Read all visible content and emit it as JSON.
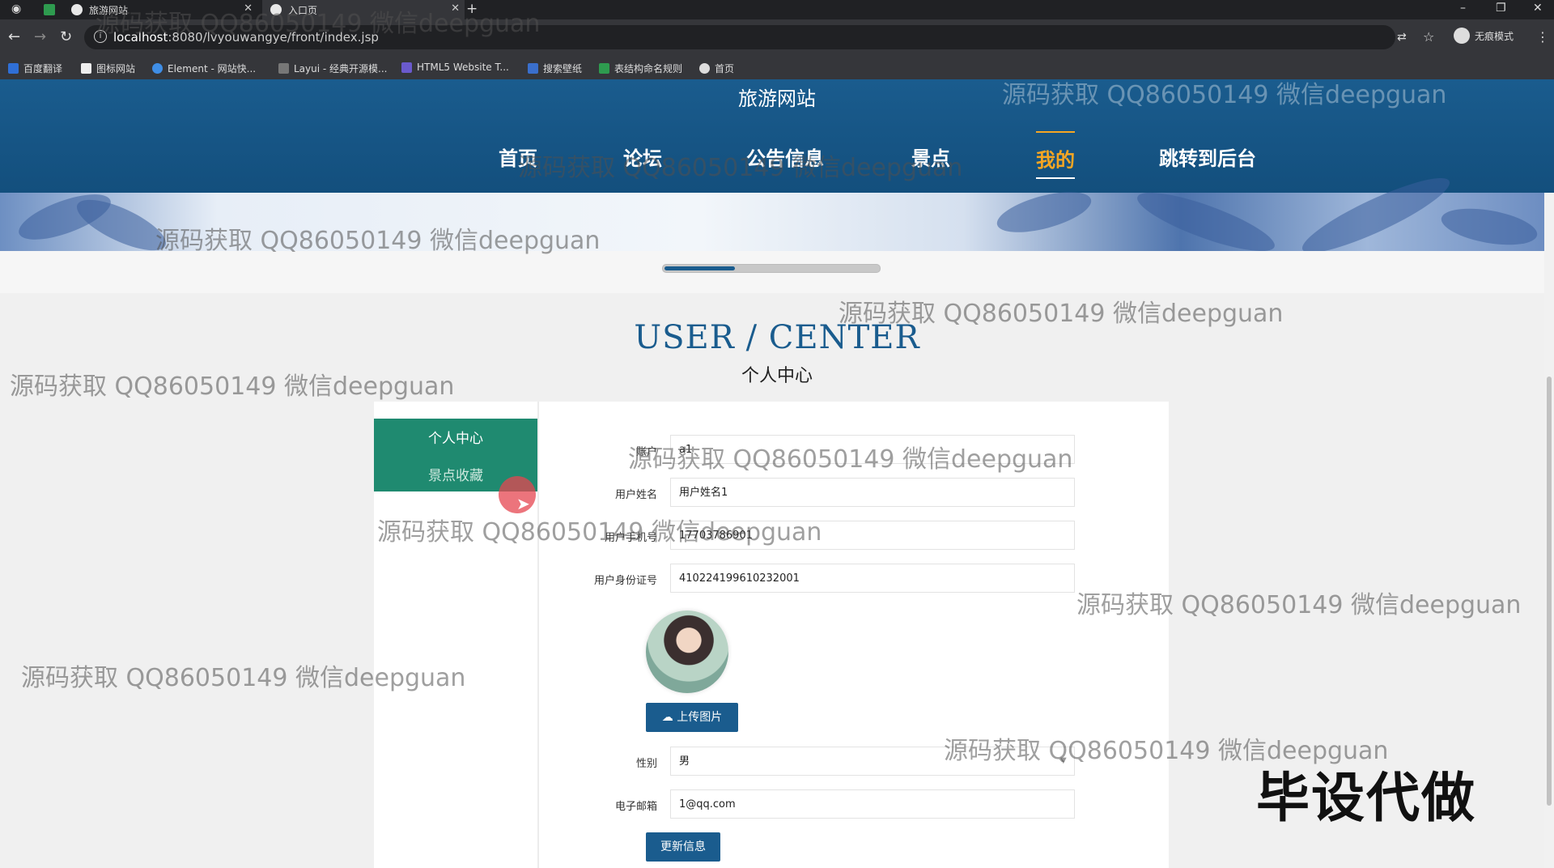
{
  "browser": {
    "tabs": [
      {
        "label": "旅游网站",
        "active": false
      },
      {
        "label": "入口页",
        "active": true
      }
    ],
    "new_tab": "+",
    "url_host": "localhost",
    "url_path": ":8080/lvyouwangye/front/index.jsp",
    "incognito_label": "无痕模式",
    "bookmarks": [
      "百度翻译",
      "图标网站",
      "Element - 网站快...",
      "Layui - 经典开源模...",
      "HTML5 Website T...",
      "搜索壁纸",
      "表结构命名规则",
      "首页"
    ]
  },
  "site": {
    "title": "旅游网站",
    "nav": [
      "首页",
      "论坛",
      "公告信息",
      "景点",
      "我的",
      "跳转到后台"
    ],
    "active_nav": "我的"
  },
  "banner": {
    "slider_progress": 0.33
  },
  "user_center": {
    "title": "USER / CENTER",
    "subtitle": "个人中心",
    "menu": [
      "个人中心",
      "景点收藏"
    ]
  },
  "form": {
    "account_label": "账户",
    "account_value": "a1",
    "name_label": "用户姓名",
    "name_value": "用户姓名1",
    "phone_label": "用户手机号",
    "phone_value": "17703786901",
    "idcard_label": "用户身份证号",
    "idcard_value": "410224199610232001",
    "upload_label": "上传图片",
    "gender_label": "性别",
    "gender_value": "男",
    "email_label": "电子邮箱",
    "email_value": "1@qq.com",
    "submit_label": "更新信息"
  },
  "watermark": "源码获取 QQ86050149 微信deepguan",
  "overlay_text": "毕设代做",
  "colors": {
    "primary": "#1a5c8e",
    "menu_green": "#1f8a70",
    "nav_active": "#f5a623"
  }
}
